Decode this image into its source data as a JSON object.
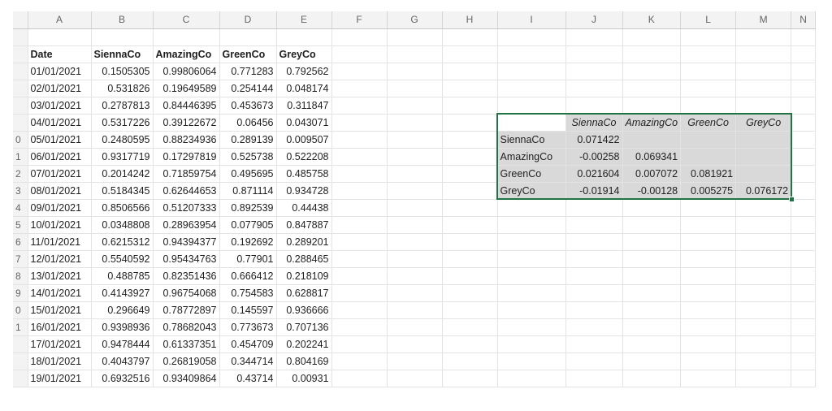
{
  "columns": [
    "A",
    "B",
    "C",
    "D",
    "E",
    "F",
    "G",
    "H",
    "I",
    "J",
    "K",
    "L",
    "M",
    "N"
  ],
  "row_numbers": [
    "",
    "",
    "",
    "",
    "",
    "",
    "0",
    "1",
    "2",
    "3",
    "4",
    "5",
    "6",
    "7",
    "8",
    "9",
    "0",
    "1"
  ],
  "data_headers": [
    "Date",
    "SiennaCo",
    "AmazingCo",
    "GreenCo",
    "GreyCo"
  ],
  "data_rows": [
    [
      "01/01/2021",
      "0.1505305",
      "0.99806064",
      "0.771283",
      "0.792562"
    ],
    [
      "02/01/2021",
      "0.531826",
      "0.19649589",
      "0.254144",
      "0.048174"
    ],
    [
      "03/01/2021",
      "0.2787813",
      "0.84446395",
      "0.453673",
      "0.311847"
    ],
    [
      "04/01/2021",
      "0.5317226",
      "0.39122672",
      "0.06456",
      "0.043071"
    ],
    [
      "05/01/2021",
      "0.2480595",
      "0.88234936",
      "0.289139",
      "0.009507"
    ],
    [
      "06/01/2021",
      "0.9317719",
      "0.17297819",
      "0.525738",
      "0.522208"
    ],
    [
      "07/01/2021",
      "0.2014242",
      "0.71859754",
      "0.495695",
      "0.485758"
    ],
    [
      "08/01/2021",
      "0.5184345",
      "0.62644653",
      "0.871114",
      "0.934728"
    ],
    [
      "09/01/2021",
      "0.8506566",
      "0.51207333",
      "0.892539",
      "0.44438"
    ],
    [
      "10/01/2021",
      "0.0348808",
      "0.28963954",
      "0.077905",
      "0.847887"
    ],
    [
      "11/01/2021",
      "0.6215312",
      "0.94394377",
      "0.192692",
      "0.289201"
    ],
    [
      "12/01/2021",
      "0.5540592",
      "0.95434763",
      "0.77901",
      "0.288465"
    ],
    [
      "13/01/2021",
      "0.488785",
      "0.82351436",
      "0.666412",
      "0.218109"
    ],
    [
      "14/01/2021",
      "0.4143927",
      "0.96754068",
      "0.754583",
      "0.628817"
    ],
    [
      "15/01/2021",
      "0.296649",
      "0.78772897",
      "0.145597",
      "0.936666"
    ],
    [
      "16/01/2021",
      "0.9398936",
      "0.78682043",
      "0.773673",
      "0.707136"
    ],
    [
      "17/01/2021",
      "0.9478444",
      "0.61337351",
      "0.454709",
      "0.202241"
    ],
    [
      "18/01/2021",
      "0.4043797",
      "0.26819058",
      "0.344714",
      "0.804169"
    ],
    [
      "19/01/2021",
      "0.6932516",
      "0.93409864",
      "0.43714",
      "0.00931"
    ]
  ],
  "correlation": {
    "headers": [
      "SiennaCo",
      "AmazingCo",
      "GreenCo",
      "GreyCo"
    ],
    "header_display": [
      "SiennaCo",
      "AmazingCo",
      "GreenCo",
      "GreyCo"
    ],
    "rows": [
      {
        "label": "SiennaCo",
        "values": [
          "0.071422",
          "",
          "",
          ""
        ]
      },
      {
        "label": "AmazingCo",
        "values": [
          "-0.00258",
          "0.069341",
          "",
          ""
        ]
      },
      {
        "label": "GreenCo",
        "values": [
          "0.021604",
          "0.007072",
          "0.081921",
          ""
        ]
      },
      {
        "label": "GreyCo",
        "values": [
          "-0.01914",
          "-0.00128",
          "0.005275",
          "0.076172"
        ]
      }
    ]
  },
  "colors": {
    "selection": "#217346",
    "shade": "#d9d9d9"
  }
}
